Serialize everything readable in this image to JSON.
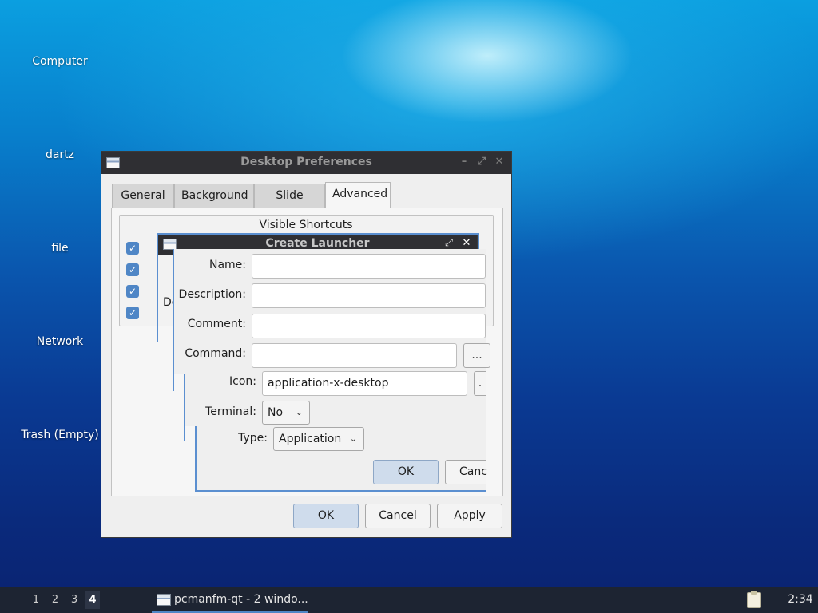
{
  "desktop": {
    "icons": [
      {
        "label": "Computer"
      },
      {
        "label": "dartz"
      },
      {
        "label": "file"
      },
      {
        "label": "Network"
      },
      {
        "label": "Trash (Empty)"
      }
    ]
  },
  "prefs_window": {
    "title": "Desktop Preferences",
    "tabs": [
      {
        "label": "General"
      },
      {
        "label": "Background"
      },
      {
        "label": "Slide Show"
      },
      {
        "label": "Advanced"
      }
    ],
    "active_tab": "Advanced",
    "group_title": "Visible Shortcuts",
    "partial_label": "De",
    "buttons": {
      "ok": "OK",
      "cancel": "Cancel",
      "apply": "Apply"
    }
  },
  "launcher_dialog": {
    "title": "Create Launcher",
    "fields": {
      "name_label": "Name:",
      "name_value": "",
      "description_label": "Description:",
      "description_value": "",
      "comment_label": "Comment:",
      "comment_value": "",
      "command_label": "Command:",
      "command_value": "",
      "browse": "...",
      "icon_label": "Icon:",
      "icon_value": "application-x-desktop",
      "icon_browse": ".",
      "terminal_label": "Terminal:",
      "terminal_value": "No",
      "type_label": "Type:",
      "type_value": "Application"
    },
    "buttons": {
      "ok": "OK",
      "cancel": "Canc"
    }
  },
  "taskbar": {
    "desktops": [
      "1",
      "2",
      "3",
      "4"
    ],
    "active_desktop": "4",
    "task": "pcmanfm-qt - 2 windo...",
    "clock": "2:34"
  }
}
